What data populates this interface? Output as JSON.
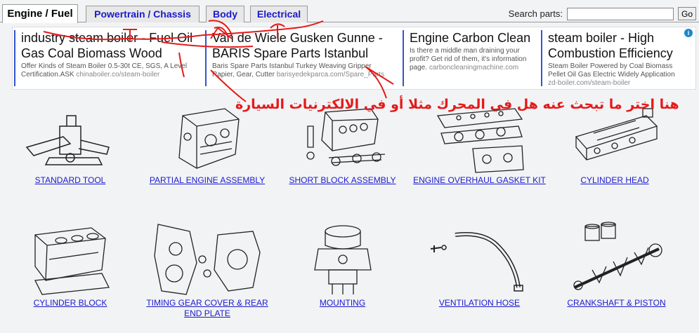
{
  "tabs": [
    {
      "label": "Engine / Fuel",
      "active": true
    },
    {
      "label": "Powertrain / Chassis",
      "active": false
    },
    {
      "label": "Body",
      "active": false
    },
    {
      "label": "Electrical",
      "active": false
    }
  ],
  "search": {
    "label": "Search parts:",
    "value": "",
    "button": "Go"
  },
  "ads": [
    {
      "title": "industry steam boiler - Fuel Oil Gas Coal Biomass Wood",
      "desc": "Offer Kinds of Steam Boiler 0.5-30t CE, SGS, A Level Certification.ASK",
      "url": "chinaboiler.co/steam-boiler"
    },
    {
      "title": "Van de Wiele Gusken Gunne - BARIS Spare Parts Istanbul",
      "desc": "Baris Spare Parts Istanbul Turkey Weaving Gripper Rapier, Gear, Cutter",
      "url": "barisyedekparca.com/Spare_Parts"
    },
    {
      "title": "Engine Carbon Clean",
      "desc": "Is there a middle man draining your profit? Get rid of them, it's information page.",
      "url": "carboncleaningmachine.com"
    },
    {
      "title": "steam boiler - High Combustion Efficiency",
      "desc": "Steam Boiler Powered by Coal Biomass Pellet Oil Gas Electric Widely Application",
      "url": "zd-boiler.com/steam-boiler"
    }
  ],
  "annotation": {
    "text": "هنا اختر ما تبحث عنه هل في المحرك مثلا أو في الالكترنيات السيارة",
    "color": "#e61919"
  },
  "parts": [
    {
      "label": "STANDARD TOOL",
      "icon": "jack-icon"
    },
    {
      "label": "PARTIAL ENGINE ASSEMBLY",
      "icon": "engine-assembly-icon"
    },
    {
      "label": "SHORT BLOCK ASSEMBLY",
      "icon": "short-block-icon"
    },
    {
      "label": "ENGINE OVERHAUL GASKET KIT",
      "icon": "gasket-kit-icon"
    },
    {
      "label": "CYLINDER HEAD",
      "icon": "cylinder-head-icon"
    },
    {
      "label": "CYLINDER BLOCK",
      "icon": "cylinder-block-icon"
    },
    {
      "label": "TIMING GEAR COVER & REAR END PLATE",
      "icon": "timing-cover-icon"
    },
    {
      "label": "MOUNTING",
      "icon": "mounting-icon"
    },
    {
      "label": "VENTILATION HOSE",
      "icon": "hose-icon"
    },
    {
      "label": "CRANKSHAFT & PISTON",
      "icon": "crankshaft-icon"
    }
  ],
  "colors": {
    "link": "#1a1acc",
    "annotation": "#e61919",
    "ad_border": "#3355cc"
  }
}
